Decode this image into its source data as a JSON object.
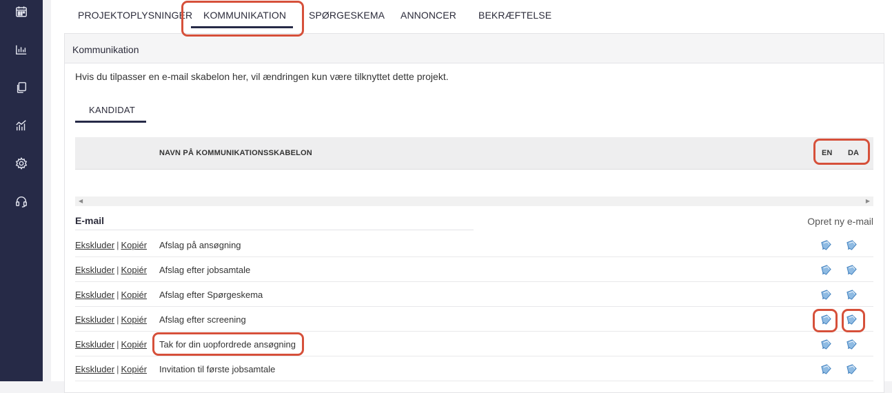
{
  "sidebar": {
    "icons": [
      "calendar-icon",
      "bar-chart-icon",
      "copy-icon",
      "analytics-icon",
      "gear-icon",
      "headset-icon"
    ]
  },
  "tabs": [
    {
      "label": "PROJEKTOPLYSNINGER",
      "active": false
    },
    {
      "label": "KOMMUNIKATION",
      "active": true
    },
    {
      "label": "SPØRGESKEMA",
      "active": false
    },
    {
      "label": "ANNONCER",
      "active": false
    },
    {
      "label": "BEKRÆFTELSE",
      "active": false
    }
  ],
  "panel": {
    "title": "Kommunikation",
    "info": "Hvis du tilpasser en e-mail skabelon her, vil ændringen kun være tilknyttet dette projekt.",
    "subtab": "KANDIDAT"
  },
  "table": {
    "header_name": "NAVN PÅ KOMMUNIKATIONSSKABELON",
    "languages": [
      "EN",
      "DA"
    ],
    "section_label": "E-mail",
    "create_link": "Opret ny e-mail",
    "exclude_label": "Ekskluder",
    "separator": "|",
    "copy_label": "Kopiér",
    "rows": [
      "Afslag på ansøgning",
      "Afslag efter jobsamtale",
      "Afslag efter Spørgeskema",
      "Afslag efter screening",
      "Tak for din uopfordrede ansøgning",
      "Invitation til første jobsamtale"
    ]
  },
  "colors": {
    "sidebar": "#262a47",
    "highlight": "#d6503a",
    "edit_icon": "#5b9bd5"
  }
}
